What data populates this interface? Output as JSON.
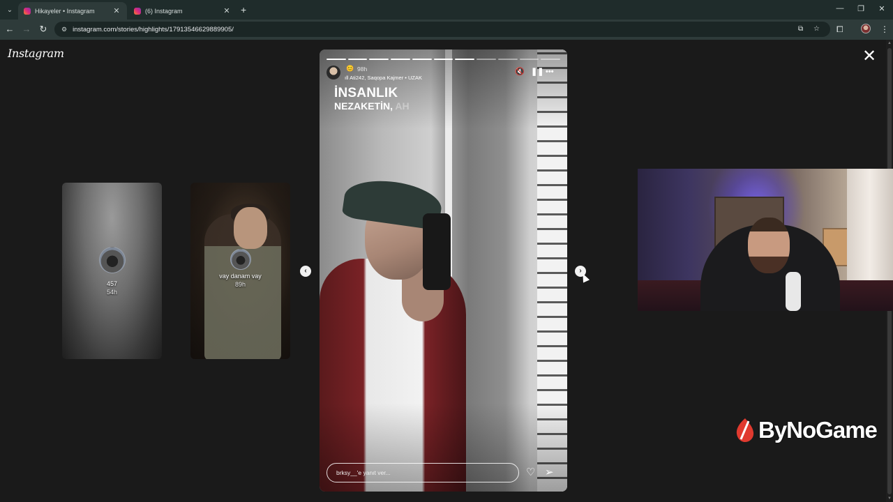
{
  "browser": {
    "tabs": [
      {
        "title": "Hikayeler • Instagram",
        "active": true
      },
      {
        "title": "(6) Instagram",
        "active": false
      }
    ],
    "url": "instagram.com/stories/highlights/17913546629889905/"
  },
  "page": {
    "logo": "Instagram",
    "previews": [
      {
        "name": "457",
        "time": "54h"
      },
      {
        "name": "vay danam vay",
        "time": "89h"
      }
    ],
    "story": {
      "progress_total": 11,
      "progress_done": 7,
      "time": "98h",
      "music": "Ati242, Saqopa Kajmer • UZAK",
      "caption_line1": "İNSANLIK",
      "caption_line2_main": "NEZAKETİN,",
      "caption_line2_faded": "AH",
      "reply_placeholder": "brksy__'e yanıt ver..."
    }
  },
  "overlay": {
    "brand": "ByNoGame",
    "brand_color": "#e03a2f"
  }
}
